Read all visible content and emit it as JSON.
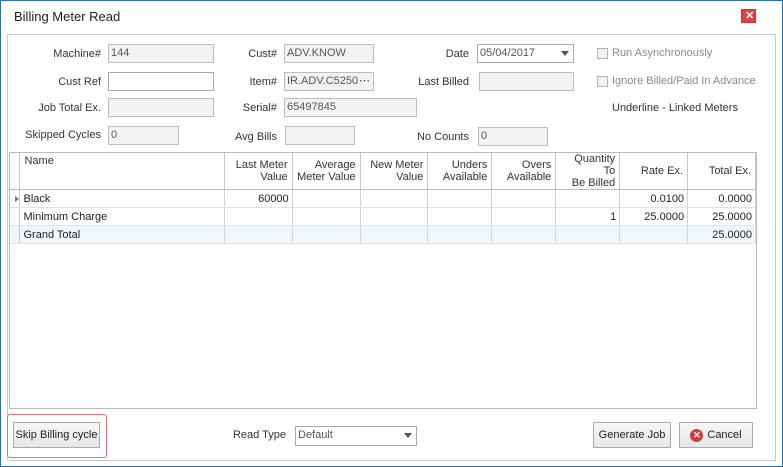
{
  "window": {
    "title": "Billing Meter Read"
  },
  "form": {
    "machine_label": "Machine#",
    "machine_value": "144",
    "cust_label": "Cust#",
    "cust_value": "ADV.KNOW",
    "date_label": "Date",
    "date_value": "05/04/2017",
    "run_async_label": "Run Asynchronously",
    "cust_ref_label": "Cust Ref",
    "cust_ref_value": "",
    "item_label": "Item#",
    "item_value": "IR.ADV.C5250",
    "last_billed_label": "Last Billed",
    "last_billed_value": "",
    "ignore_billed_label": "Ignore Billed/Paid In Advance",
    "job_total_label": "Job Total Ex.",
    "job_total_value": "",
    "serial_label": "Serial#",
    "serial_value": "65497845",
    "underline_note": "Underline - Linked Meters",
    "skipped_label": "Skipped Cycles",
    "skipped_value": "0",
    "avg_bills_label": "Avg Bills",
    "avg_bills_value": "",
    "no_counts_label": "No Counts",
    "no_counts_value": "0"
  },
  "grid": {
    "columns": [
      "Name",
      "Last Meter Value",
      "Average Meter Value",
      "New Meter Value",
      "Unders Available",
      "Overs Available",
      "Quantity To Be Billed",
      "Rate Ex.",
      "Total Ex."
    ],
    "column_lines": [
      [
        "Name",
        ""
      ],
      [
        "Last Meter",
        "Value"
      ],
      [
        "Average",
        "Meter Value"
      ],
      [
        "New Meter",
        "Value"
      ],
      [
        "Unders",
        "Available"
      ],
      [
        "Overs",
        "Available"
      ],
      [
        "Quantity To",
        "Be Billed"
      ],
      [
        "Rate Ex.",
        ""
      ],
      [
        "Total Ex.",
        ""
      ]
    ],
    "rows": [
      [
        "Black",
        "60000",
        "",
        "",
        "",
        "",
        "",
        "0.0100",
        "0.0000"
      ],
      [
        "Minimum Charge",
        "",
        "",
        "",
        "",
        "",
        "1",
        "25.0000",
        "25.0000"
      ],
      [
        "Grand Total",
        "",
        "",
        "",
        "",
        "",
        "",
        "",
        "25.0000"
      ]
    ]
  },
  "footer": {
    "skip_label": "Skip Billing cycle",
    "read_type_label": "Read Type",
    "read_type_value": "Default",
    "generate_label": "Generate Job",
    "cancel_label": "Cancel"
  },
  "icons": {
    "close": "close-icon",
    "cancel": "cancel-icon",
    "dropdown": "chevron-down-icon",
    "row_indicator": "row-pointer-icon",
    "ellipsis": "ellipsis-icon"
  },
  "colors": {
    "window_border": "#2f6fb0",
    "close_button": "#e04343",
    "total_row": "#eef7fc",
    "highlight_outline": "#e07070"
  }
}
